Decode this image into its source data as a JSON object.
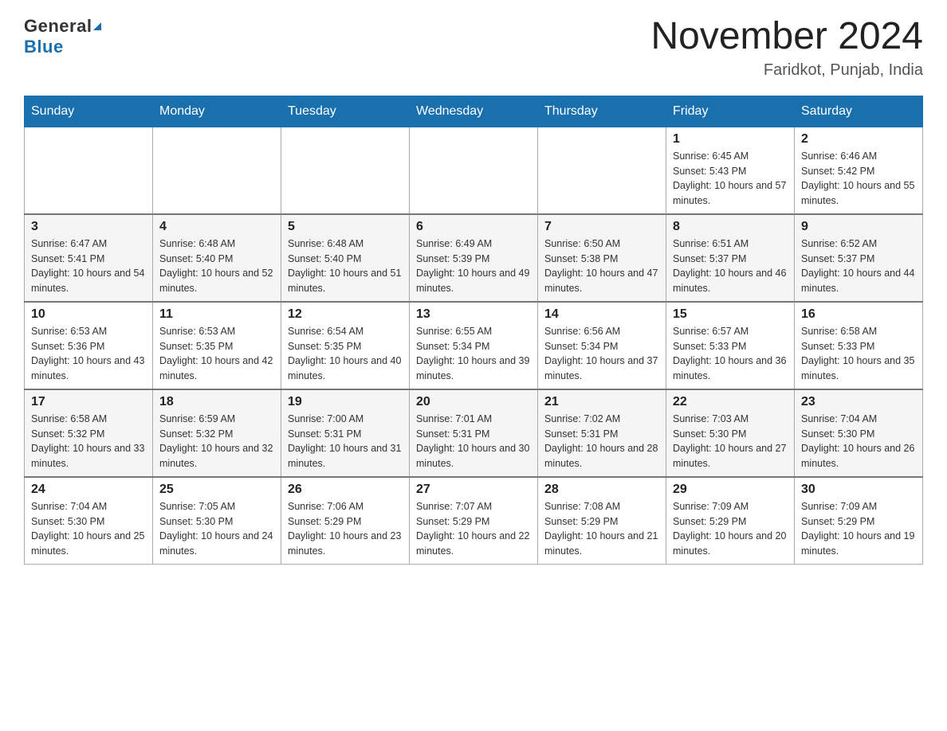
{
  "logo": {
    "general_text": "General",
    "blue_text": "Blue"
  },
  "title": {
    "month_year": "November 2024",
    "location": "Faridkot, Punjab, India"
  },
  "days_of_week": [
    "Sunday",
    "Monday",
    "Tuesday",
    "Wednesday",
    "Thursday",
    "Friday",
    "Saturday"
  ],
  "weeks": [
    [
      {
        "day": "",
        "info": ""
      },
      {
        "day": "",
        "info": ""
      },
      {
        "day": "",
        "info": ""
      },
      {
        "day": "",
        "info": ""
      },
      {
        "day": "",
        "info": ""
      },
      {
        "day": "1",
        "info": "Sunrise: 6:45 AM\nSunset: 5:43 PM\nDaylight: 10 hours and 57 minutes."
      },
      {
        "day": "2",
        "info": "Sunrise: 6:46 AM\nSunset: 5:42 PM\nDaylight: 10 hours and 55 minutes."
      }
    ],
    [
      {
        "day": "3",
        "info": "Sunrise: 6:47 AM\nSunset: 5:41 PM\nDaylight: 10 hours and 54 minutes."
      },
      {
        "day": "4",
        "info": "Sunrise: 6:48 AM\nSunset: 5:40 PM\nDaylight: 10 hours and 52 minutes."
      },
      {
        "day": "5",
        "info": "Sunrise: 6:48 AM\nSunset: 5:40 PM\nDaylight: 10 hours and 51 minutes."
      },
      {
        "day": "6",
        "info": "Sunrise: 6:49 AM\nSunset: 5:39 PM\nDaylight: 10 hours and 49 minutes."
      },
      {
        "day": "7",
        "info": "Sunrise: 6:50 AM\nSunset: 5:38 PM\nDaylight: 10 hours and 47 minutes."
      },
      {
        "day": "8",
        "info": "Sunrise: 6:51 AM\nSunset: 5:37 PM\nDaylight: 10 hours and 46 minutes."
      },
      {
        "day": "9",
        "info": "Sunrise: 6:52 AM\nSunset: 5:37 PM\nDaylight: 10 hours and 44 minutes."
      }
    ],
    [
      {
        "day": "10",
        "info": "Sunrise: 6:53 AM\nSunset: 5:36 PM\nDaylight: 10 hours and 43 minutes."
      },
      {
        "day": "11",
        "info": "Sunrise: 6:53 AM\nSunset: 5:35 PM\nDaylight: 10 hours and 42 minutes."
      },
      {
        "day": "12",
        "info": "Sunrise: 6:54 AM\nSunset: 5:35 PM\nDaylight: 10 hours and 40 minutes."
      },
      {
        "day": "13",
        "info": "Sunrise: 6:55 AM\nSunset: 5:34 PM\nDaylight: 10 hours and 39 minutes."
      },
      {
        "day": "14",
        "info": "Sunrise: 6:56 AM\nSunset: 5:34 PM\nDaylight: 10 hours and 37 minutes."
      },
      {
        "day": "15",
        "info": "Sunrise: 6:57 AM\nSunset: 5:33 PM\nDaylight: 10 hours and 36 minutes."
      },
      {
        "day": "16",
        "info": "Sunrise: 6:58 AM\nSunset: 5:33 PM\nDaylight: 10 hours and 35 minutes."
      }
    ],
    [
      {
        "day": "17",
        "info": "Sunrise: 6:58 AM\nSunset: 5:32 PM\nDaylight: 10 hours and 33 minutes."
      },
      {
        "day": "18",
        "info": "Sunrise: 6:59 AM\nSunset: 5:32 PM\nDaylight: 10 hours and 32 minutes."
      },
      {
        "day": "19",
        "info": "Sunrise: 7:00 AM\nSunset: 5:31 PM\nDaylight: 10 hours and 31 minutes."
      },
      {
        "day": "20",
        "info": "Sunrise: 7:01 AM\nSunset: 5:31 PM\nDaylight: 10 hours and 30 minutes."
      },
      {
        "day": "21",
        "info": "Sunrise: 7:02 AM\nSunset: 5:31 PM\nDaylight: 10 hours and 28 minutes."
      },
      {
        "day": "22",
        "info": "Sunrise: 7:03 AM\nSunset: 5:30 PM\nDaylight: 10 hours and 27 minutes."
      },
      {
        "day": "23",
        "info": "Sunrise: 7:04 AM\nSunset: 5:30 PM\nDaylight: 10 hours and 26 minutes."
      }
    ],
    [
      {
        "day": "24",
        "info": "Sunrise: 7:04 AM\nSunset: 5:30 PM\nDaylight: 10 hours and 25 minutes."
      },
      {
        "day": "25",
        "info": "Sunrise: 7:05 AM\nSunset: 5:30 PM\nDaylight: 10 hours and 24 minutes."
      },
      {
        "day": "26",
        "info": "Sunrise: 7:06 AM\nSunset: 5:29 PM\nDaylight: 10 hours and 23 minutes."
      },
      {
        "day": "27",
        "info": "Sunrise: 7:07 AM\nSunset: 5:29 PM\nDaylight: 10 hours and 22 minutes."
      },
      {
        "day": "28",
        "info": "Sunrise: 7:08 AM\nSunset: 5:29 PM\nDaylight: 10 hours and 21 minutes."
      },
      {
        "day": "29",
        "info": "Sunrise: 7:09 AM\nSunset: 5:29 PM\nDaylight: 10 hours and 20 minutes."
      },
      {
        "day": "30",
        "info": "Sunrise: 7:09 AM\nSunset: 5:29 PM\nDaylight: 10 hours and 19 minutes."
      }
    ]
  ]
}
